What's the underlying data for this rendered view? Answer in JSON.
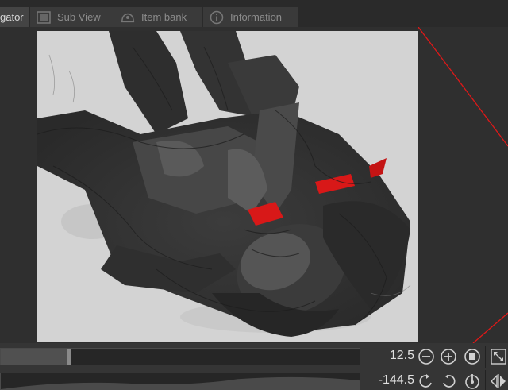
{
  "tabs": [
    {
      "label": "gator",
      "icon": "navigator-icon",
      "active": true
    },
    {
      "label": "Sub View",
      "icon": "sub-view-icon",
      "active": false
    },
    {
      "label": "Item bank",
      "icon": "item-bank-icon",
      "active": false
    },
    {
      "label": "Information",
      "icon": "information-icon",
      "active": false
    }
  ],
  "zoom": {
    "value": "12.5",
    "level": 0.19,
    "zoom_out_icon": "zoom-out-icon",
    "zoom_in_icon": "zoom-in-icon",
    "fit_icon": "fit-to-window-icon",
    "actual_size_icon": "actual-size-icon"
  },
  "rotation": {
    "value": "-144.5",
    "rotate_left_icon": "rotate-left-icon",
    "rotate_right_icon": "rotate-right-icon",
    "reset_icon": "reset-rotation-icon",
    "flip_icon": "flip-horizontal-icon"
  },
  "colors": {
    "accent_red": "#e01818",
    "canvas_bg": "#d3d3d3",
    "panel_bg": "#2d2d2d"
  }
}
